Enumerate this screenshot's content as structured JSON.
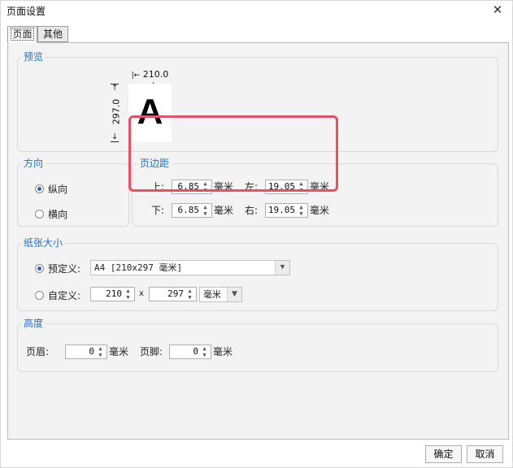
{
  "window": {
    "title": "页面设置",
    "close": "✕"
  },
  "tabs": [
    {
      "label": "页面",
      "active": true
    },
    {
      "label": "其他",
      "active": false
    }
  ],
  "preview": {
    "title": "预览",
    "width_label": "210.0",
    "height_label": "297.0",
    "letter": "A"
  },
  "orientation": {
    "title": "方向",
    "options": [
      {
        "label": "纵向",
        "checked": true
      },
      {
        "label": "横向",
        "checked": false
      }
    ]
  },
  "margins": {
    "title": "页边距",
    "top": {
      "label": "上:",
      "value": "6.85",
      "unit": "毫米"
    },
    "left": {
      "label": "左:",
      "value": "19.05",
      "unit": "毫米"
    },
    "bottom": {
      "label": "下:",
      "value": "6.85",
      "unit": "毫米"
    },
    "right": {
      "label": "右:",
      "value": "19.05",
      "unit": "毫米"
    }
  },
  "paper": {
    "title": "纸张大小",
    "predefined": {
      "label": "预定义:",
      "checked": true,
      "value": "A4 [210x297 毫米]"
    },
    "custom": {
      "label": "自定义:",
      "checked": false,
      "width": "210",
      "x": "x",
      "height": "297",
      "unit": "毫米"
    }
  },
  "height": {
    "title": "高度",
    "header": {
      "label": "页眉:",
      "value": "0",
      "unit": "毫米"
    },
    "footer": {
      "label": "页脚:",
      "value": "0",
      "unit": "毫米"
    }
  },
  "buttons": {
    "ok": "确定",
    "cancel": "取消"
  },
  "colors": {
    "accent": "#1f6fd1",
    "highlight": "#e8515f",
    "radio": "#2b63c6"
  },
  "icons": {
    "spin_up": "▲",
    "spin_down": "▼",
    "caret": "▼"
  }
}
